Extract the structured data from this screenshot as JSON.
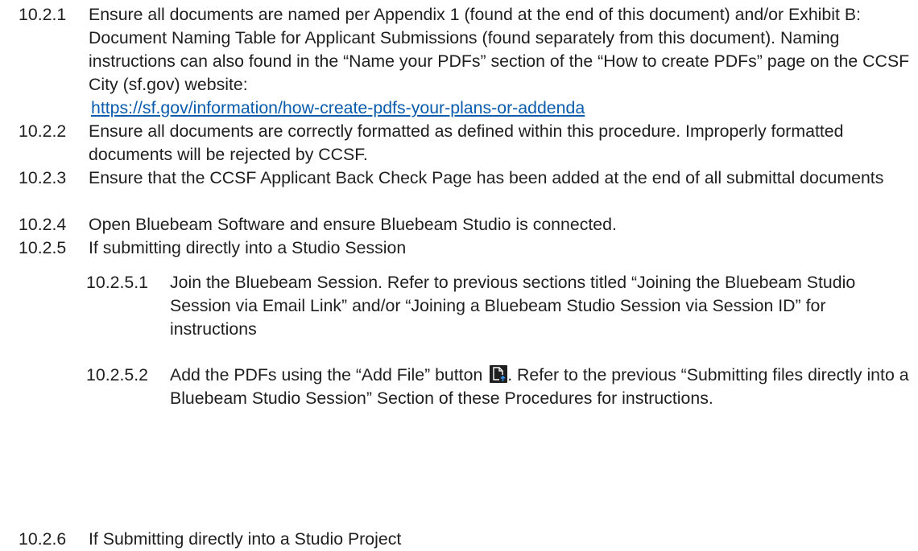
{
  "items": [
    {
      "number": "10.2.1",
      "text": "Ensure all documents are named per Appendix 1 (found at the end of this document) and/or Exhibit B: Document Naming Table for Applicant Submissions (found separately from this document). Naming instructions can also found in the “Name your PDFs” section of the “How to create PDFs” page on the CCSF City (sf.gov) website:",
      "link": "https://sf.gov/information/how-create-pdfs-your-plans-or-addenda"
    },
    {
      "number": "10.2.2",
      "text": "Ensure all documents are correctly formatted as defined within this procedure. Improperly formatted documents will be rejected by CCSF."
    },
    {
      "number": "10.2.3",
      "text": "Ensure that the CCSF Applicant Back Check Page has been added at the end of all submittal documents"
    },
    {
      "number": "10.2.4",
      "text": "Open Bluebeam Software and ensure Bluebeam Studio is connected."
    },
    {
      "number": "10.2.5",
      "text": "If submitting directly into a Studio Session"
    },
    {
      "number": "10.2.6",
      "text": "If Submitting directly into a Studio Project"
    }
  ],
  "subitems": [
    {
      "number": "10.2.5.1",
      "text": "Join the Bluebeam Session. Refer to previous sections titled “Joining the Bluebeam Studio Session via Email Link” and/or “Joining a Bluebeam Studio Session via Session ID” for instructions"
    },
    {
      "number": "10.2.5.2",
      "text_before": "Add the PDFs using the “Add File” button",
      "icon": "add-file-icon",
      "text_after": ". Refer to the previous “Submitting files directly into a Bluebeam Studio Session” Section of these Procedures for instructions."
    }
  ]
}
